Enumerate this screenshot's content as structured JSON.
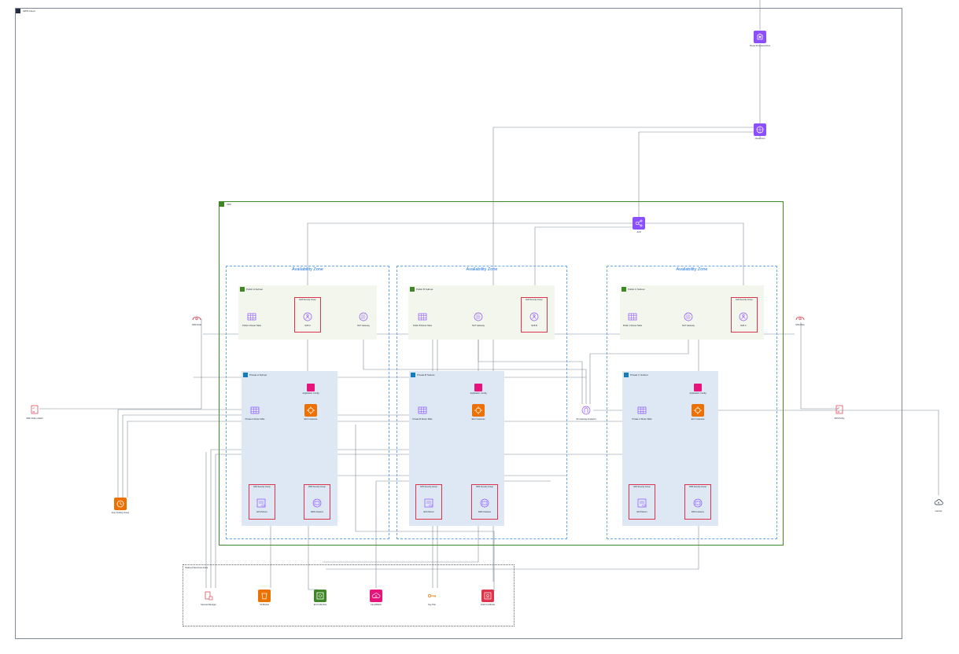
{
  "cloud": {
    "label": "AWS Cloud"
  },
  "vpc": {
    "label": "VPC"
  },
  "availability_zones": [
    "Availability Zone",
    "Availability Zone",
    "Availability Zone"
  ],
  "subnets": {
    "public_a": "Public A Subnet",
    "public_b": "Public B Subnet",
    "public_c": "Public C Subnet",
    "private_a": "Private A Subnet",
    "private_b": "Private B Subnet",
    "private_c": "Private C Subnet"
  },
  "security_groups": {
    "elb_a": "ELB Security Group",
    "elb_b": "ELB Security Group",
    "elb_c": "ELB Security Group",
    "efs_a": "EFS Security Group",
    "efs_b": "EFS Security Group",
    "efs_c": "EFS Security Group",
    "rds_a": "RDS Security Group",
    "rds_b": "RDS Security Group",
    "rds_c": "RDS Security Group"
  },
  "shared_services": {
    "label": "Shared Services Area"
  },
  "services": {
    "route53": "Route 53 Hosted Zone",
    "cloudfront": "CloudFront",
    "alb": "ALB",
    "nlb_a": "NLB A",
    "nlb_b": "NLB B",
    "nlb_c": "NLB C",
    "natgw_a": "NAT Gateway",
    "natgw_b": "NAT Gateway",
    "natgw_c": "NAT Gateway",
    "rt_pub_a": "Public A Route Table",
    "rt_pub_b": "Public B Route Table",
    "rt_pub_c": "Public C Route Table",
    "rt_priv_a": "Private A Route Table",
    "rt_priv_b": "Private B Route Table",
    "rt_priv_c": "Private C Route Table",
    "cfg_a": "Application Config",
    "cfg_b": "Application Config",
    "cfg_c": "Application Config",
    "ec2_a": "EC2 Instances",
    "ec2_b": "EC2 Instances",
    "ec2_c": "EC2 Instances",
    "efs_a": "EFS Mount",
    "efs_b": "EFS Mount",
    "efs_c": "EFS Mount",
    "rds_a": "RDS Instance",
    "rds_b": "RDS Instance",
    "rds_c": "RDS Instance",
    "vpc_endpoint": "S3 Gateway Endpoint",
    "ec2_role": "EC2 IAM Role",
    "auto_scaling": "Auto Scaling Group",
    "waf_role": "WAF Role",
    "waf_policy": "WAF Policy Attach",
    "sns_role": "SNS Role",
    "sns_policy": "SNS Policy",
    "internet": "Internet",
    "secrets": "Secrets Manager",
    "s3": "S3 Bucket",
    "kms": "KMS Key",
    "cw": "CloudWatch",
    "key": "Key Pair",
    "cert": "ACM Certificate"
  },
  "colors": {
    "compute": "#ed7100",
    "network": "#8c4fff",
    "storage": "#3f8624",
    "management": "#e7157b",
    "security": "#dd344c",
    "vpc_border": "#3f8624",
    "az_border": "#6aa6f0",
    "public_fill": "#f2f6ec",
    "private_fill": "#dde8f4"
  }
}
